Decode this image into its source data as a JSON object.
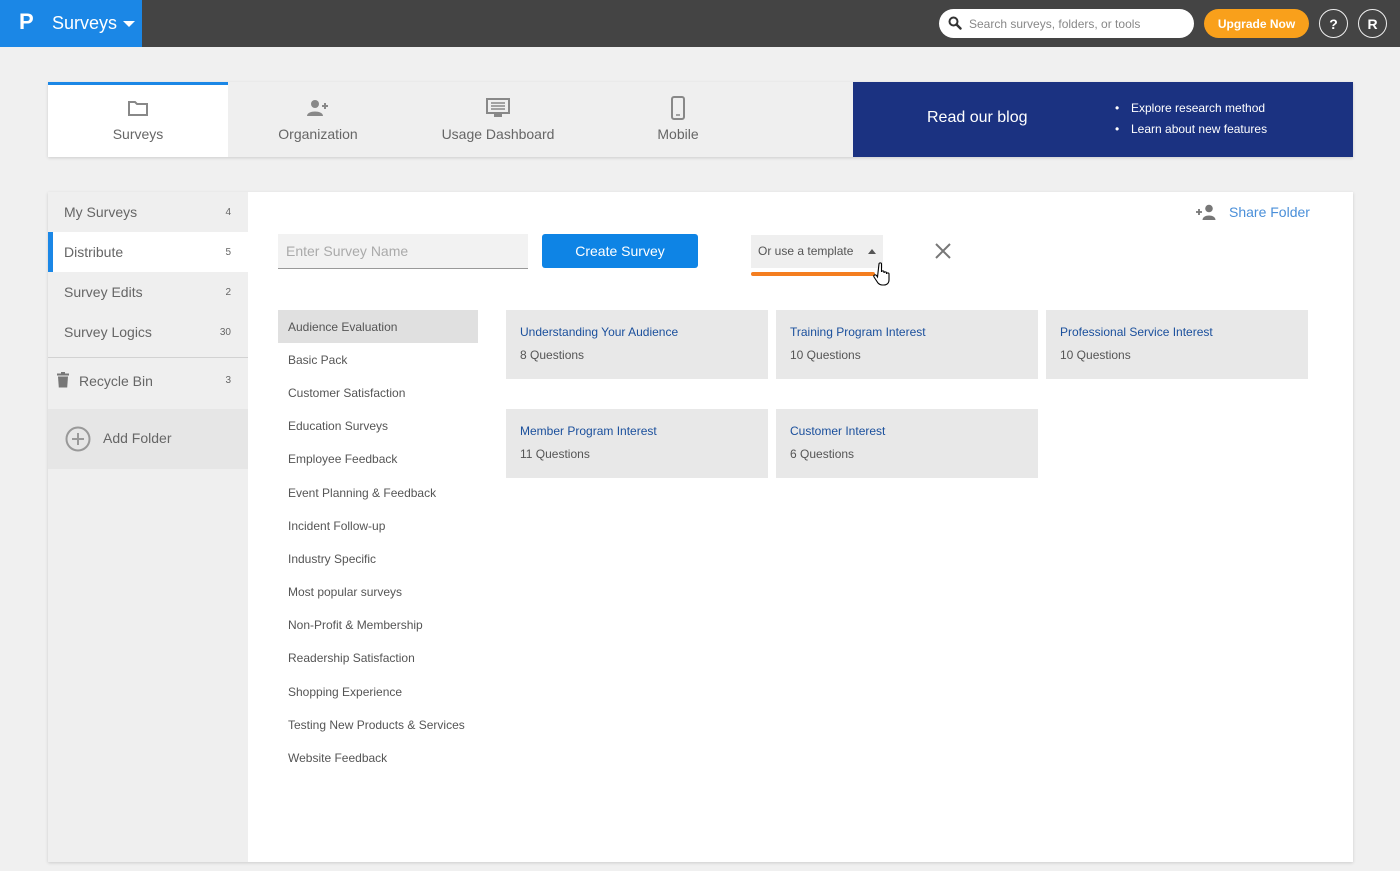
{
  "topbar": {
    "logo": "P",
    "app_title": "Surveys",
    "search_placeholder": "Search surveys, folders, or tools",
    "upgrade_label": "Upgrade Now",
    "help_label": "?",
    "user_initial": "R"
  },
  "tabs": [
    {
      "label": "Surveys",
      "icon": "folder-icon",
      "active": true
    },
    {
      "label": "Organization",
      "icon": "add-user-icon",
      "active": false
    },
    {
      "label": "Usage Dashboard",
      "icon": "dashboard-icon",
      "active": false
    },
    {
      "label": "Mobile",
      "icon": "mobile-icon",
      "active": false
    }
  ],
  "blog": {
    "title": "Read our blog",
    "bullets": [
      "Explore research method",
      "Learn about new features"
    ]
  },
  "sidebar": {
    "items": [
      {
        "label": "My Surveys",
        "count": "4"
      },
      {
        "label": "Distribute",
        "count": "5",
        "active": true
      },
      {
        "label": "Survey Edits",
        "count": "2"
      },
      {
        "label": "Survey Logics",
        "count": "30"
      }
    ],
    "recycle_bin": {
      "label": "Recycle Bin",
      "count": "3"
    },
    "add_folder_label": "Add Folder"
  },
  "main": {
    "share_folder_label": "Share Folder",
    "survey_name_placeholder": "Enter Survey Name",
    "survey_name_value": "",
    "create_button_label": "Create Survey",
    "template_dropdown_label": "Or use a template",
    "accent_color": "#f47e20",
    "categories": [
      "Audience Evaluation",
      "Basic Pack",
      "Customer Satisfaction",
      "Education Surveys",
      "Employee Feedback",
      "Event Planning & Feedback",
      "Incident Follow-up",
      "Industry Specific",
      "Most popular surveys",
      "Non-Profit & Membership",
      "Readership Satisfaction",
      "Shopping Experience",
      "Testing New Products & Services",
      "Website Feedback"
    ],
    "selected_category": "Audience Evaluation",
    "templates": [
      {
        "title": "Understanding Your Audience",
        "questions": "8 Questions"
      },
      {
        "title": "Training Program Interest",
        "questions": "10 Questions"
      },
      {
        "title": "Professional Service Interest",
        "questions": "10 Questions"
      },
      {
        "title": "Member Program Interest",
        "questions": "11 Questions"
      },
      {
        "title": "Customer Interest",
        "questions": "6 Questions"
      }
    ]
  }
}
